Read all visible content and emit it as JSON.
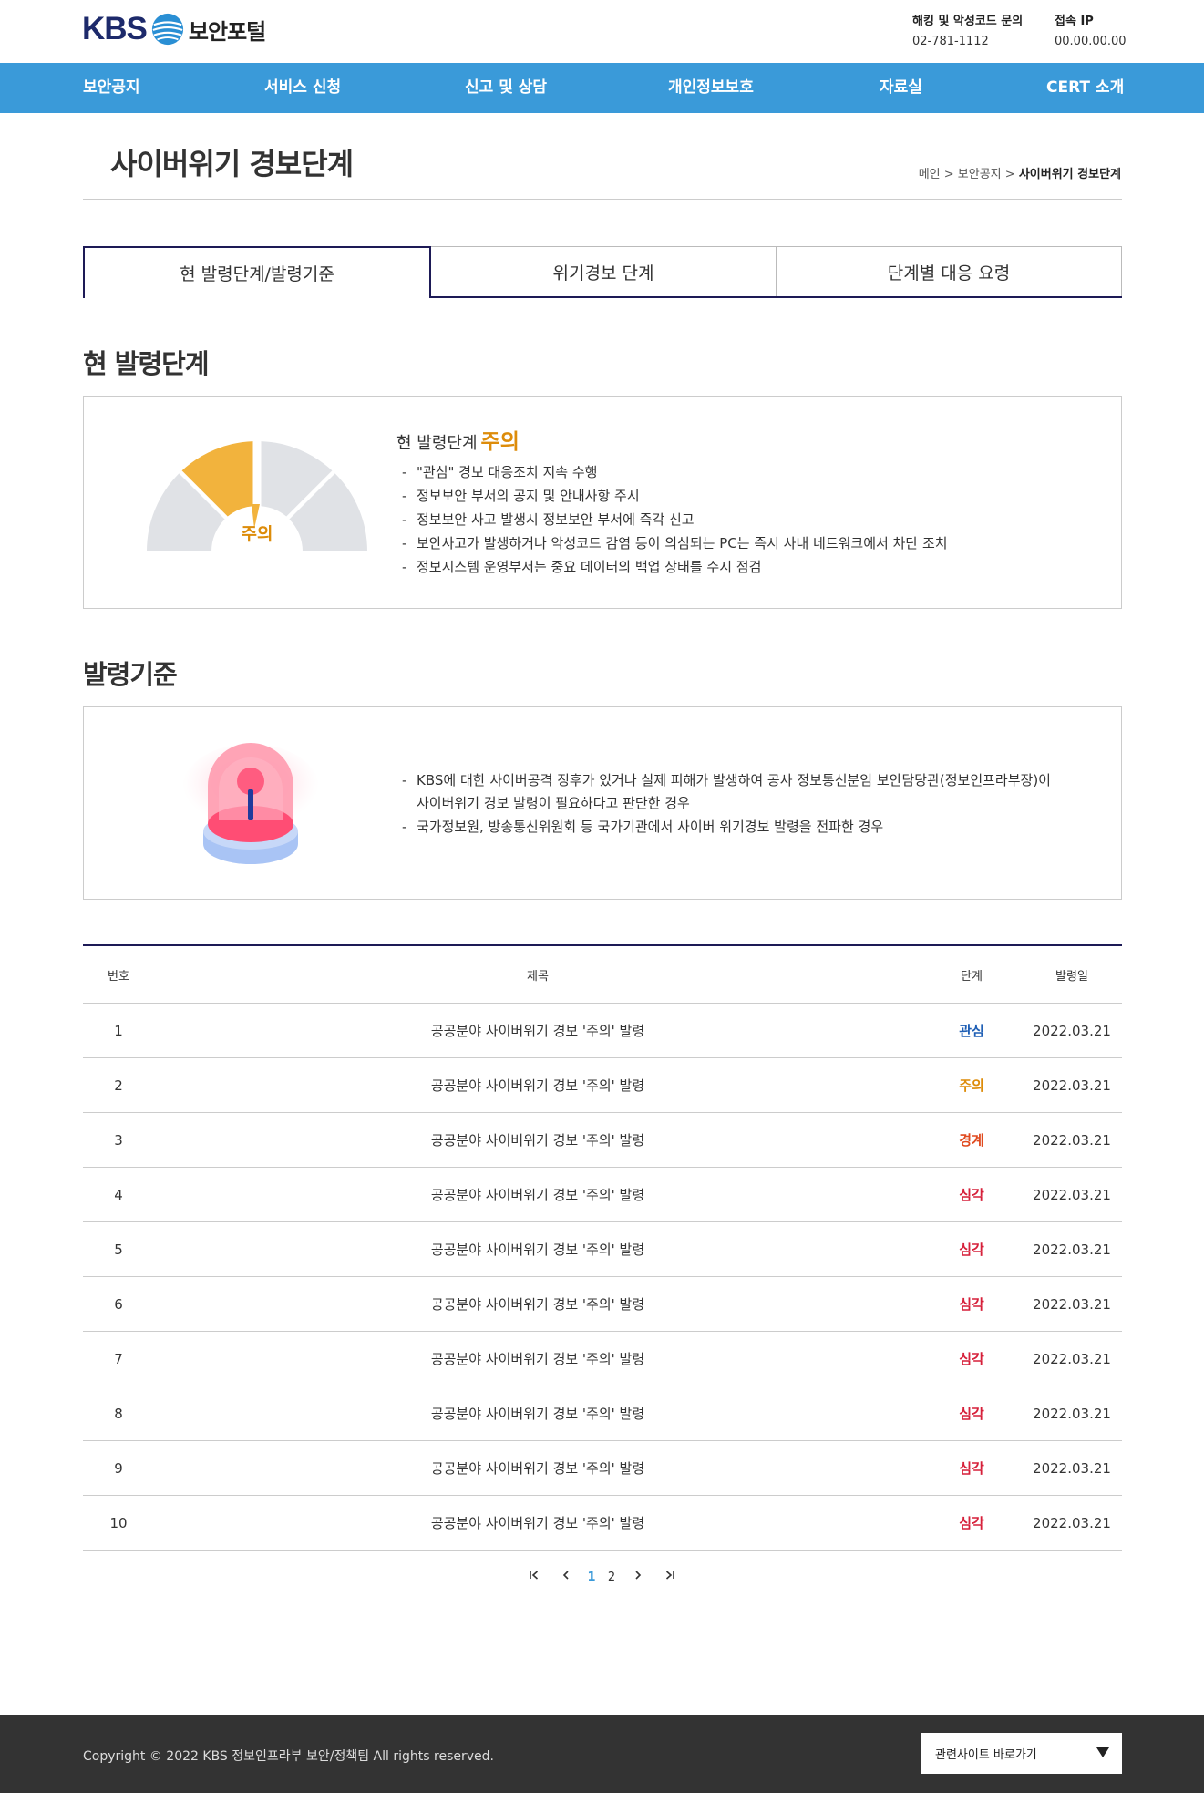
{
  "header": {
    "logo_kbs": "KBS",
    "logo_text": "보안포털",
    "contact": [
      {
        "label": "해킹 및 악성코드 문의",
        "value": "02-781-1112"
      },
      {
        "label": "접속 IP",
        "value": "00.00.00.00"
      }
    ]
  },
  "nav": {
    "items": [
      "보안공지",
      "서비스 신청",
      "신고 및 상담",
      "개인정보보호",
      "자료실",
      "CERT 소개"
    ]
  },
  "page": {
    "title": "사이버위기 경보단계",
    "breadcrumb": {
      "home": "메인",
      "sep": ">",
      "parent": "보안공지",
      "current": "사이버위기 경보단계"
    }
  },
  "tabs": [
    "현 발령단계/발령기준",
    "위기경보 단계",
    "단계별 대응 요령"
  ],
  "current_stage": {
    "section_title": "현 발령단계",
    "gauge_label": "주의",
    "head_prefix": "현 발령단계",
    "level": "주의",
    "bullets": [
      "\"관심\" 경보 대응조치 지속 수행",
      "정보보안 부서의 공지 및 안내사항 주시",
      "정보보안 사고 발생시 정보보안 부서에 즉각 신고",
      "보안사고가 발생하거나 악성코드 감염 등이 의심되는 PC는 즉시 사내 네트워크에서 차단 조치",
      "정보시스템 운영부서는 중요 데이터의 백업 상태를 수시 점검"
    ]
  },
  "criteria": {
    "section_title": "발령기준",
    "bullets": [
      "KBS에 대한 사이버공격 징후가 있거나 실제 피해가 발생하여 공사 정보통신분임 보안담당관(정보인프라부장)이",
      "사이버위기 경보 발령이 필요하다고 판단한 경우",
      "국가정보원, 방송통신위원회 등 국가기관에서 사이버 위기경보 발령을 전파한 경우"
    ]
  },
  "table": {
    "headers": {
      "no": "번호",
      "title": "제목",
      "stage": "단계",
      "date": "발령일"
    },
    "rows": [
      {
        "no": "1",
        "title": "공공분야 사이버위기 경보 '주의' 발령",
        "stage": "관심",
        "date": "2022.03.21"
      },
      {
        "no": "2",
        "title": "공공분야 사이버위기 경보 '주의' 발령",
        "stage": "주의",
        "date": "2022.03.21"
      },
      {
        "no": "3",
        "title": "공공분야 사이버위기 경보 '주의' 발령",
        "stage": "경계",
        "date": "2022.03.21"
      },
      {
        "no": "4",
        "title": "공공분야 사이버위기 경보 '주의' 발령",
        "stage": "심각",
        "date": "2022.03.21"
      },
      {
        "no": "5",
        "title": "공공분야 사이버위기 경보 '주의' 발령",
        "stage": "심각",
        "date": "2022.03.21"
      },
      {
        "no": "6",
        "title": "공공분야 사이버위기 경보 '주의' 발령",
        "stage": "심각",
        "date": "2022.03.21"
      },
      {
        "no": "7",
        "title": "공공분야 사이버위기 경보 '주의' 발령",
        "stage": "심각",
        "date": "2022.03.21"
      },
      {
        "no": "8",
        "title": "공공분야 사이버위기 경보 '주의' 발령",
        "stage": "심각",
        "date": "2022.03.21"
      },
      {
        "no": "9",
        "title": "공공분야 사이버위기 경보 '주의' 발령",
        "stage": "심각",
        "date": "2022.03.21"
      },
      {
        "no": "10",
        "title": "공공분야 사이버위기 경보 '주의' 발령",
        "stage": "심각",
        "date": "2022.03.21"
      }
    ]
  },
  "stage_colors": {
    "관심": "#1f5fb5",
    "주의": "#dd8c0a",
    "경계": "#e04a1f",
    "심각": "#d6203a"
  },
  "pagination": {
    "first_icon": "first-page-icon",
    "prev_icon": "prev-page-icon",
    "pages": [
      "1",
      "2"
    ],
    "current": "1",
    "next_icon": "next-page-icon",
    "last_icon": "last-page-icon"
  },
  "footer": {
    "copyright": "Copyright © 2022 KBS 정보인프라부 보안/정책팀 All rights reserved.",
    "family_site": "관련사이트 바로가기"
  },
  "colors": {
    "nav": "#3a9ad9",
    "accent_dark": "#1d1a56",
    "gauge_active": "#f2b33d",
    "footer": "#333333"
  }
}
